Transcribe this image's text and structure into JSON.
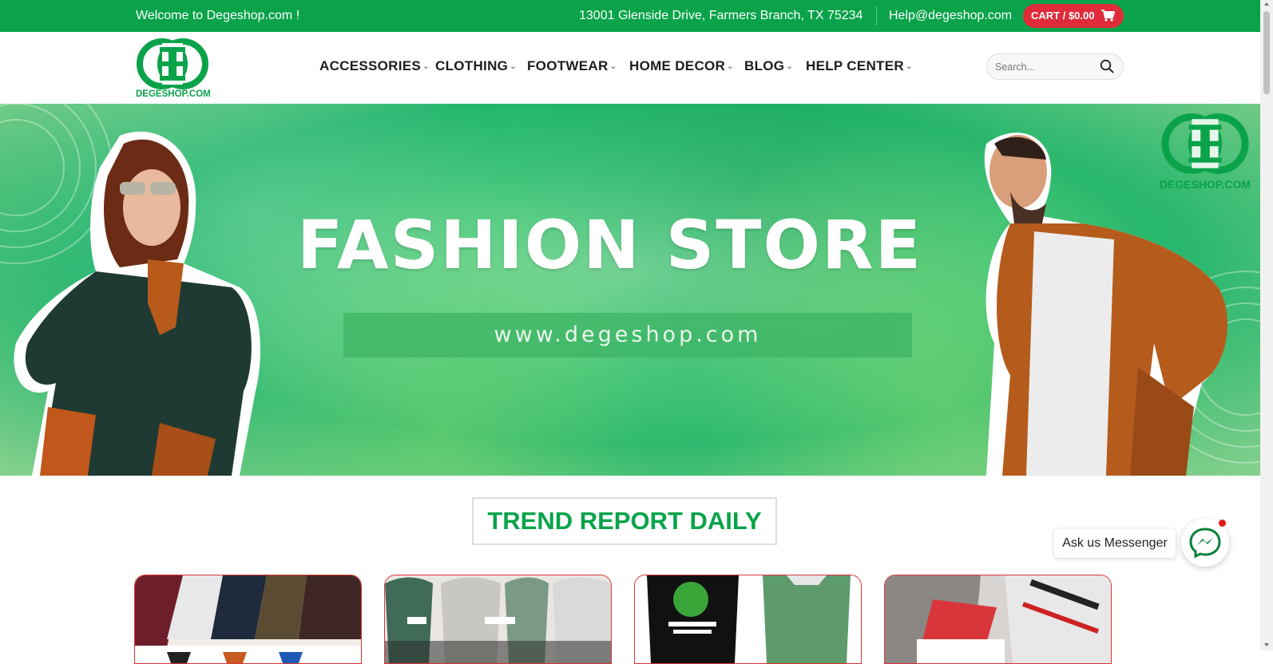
{
  "topbar": {
    "welcome": "Welcome to Degeshop.com !",
    "address": "13001 Glenside Drive, Farmers Branch, TX 75234",
    "email": "Help@degeshop.com",
    "cart_label": "CART / $0.00"
  },
  "header": {
    "logo_text": "DEGESHOP.COM",
    "nav": [
      {
        "label": "ACCESSORIES"
      },
      {
        "label": "CLOTHING"
      },
      {
        "label": "FOOTWEAR"
      },
      {
        "label": "HOME DECOR"
      },
      {
        "label": "BLOG"
      },
      {
        "label": "HELP CENTER"
      }
    ],
    "search": {
      "placeholder": "Search...",
      "value": ""
    }
  },
  "hero": {
    "title": "FASHION STORE",
    "url": "www.degeshop.com",
    "logo_text": "DEGESHOP.COM"
  },
  "section": {
    "title": "TREND REPORT DAILY"
  },
  "messenger": {
    "label": "Ask us Messenger"
  },
  "colors": {
    "brand_green": "#0aa34a",
    "cart_red": "#e02b3a",
    "card_border": "#dd3333"
  },
  "icons": [
    "cart-icon",
    "search-icon",
    "chevron-down-icon",
    "messenger-icon",
    "logo-icon"
  ]
}
